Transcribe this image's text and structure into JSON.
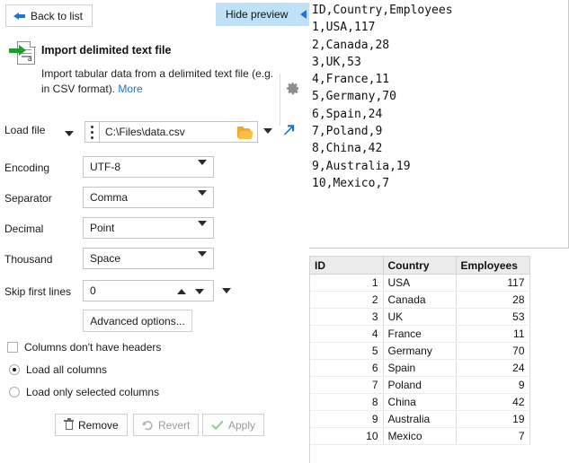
{
  "toolbar": {
    "back_label": "Back to list",
    "back_icon": "arrow-left-icon",
    "hide_preview_label": "Hide preview",
    "hide_preview_icon": "triangle-left-icon"
  },
  "header": {
    "icon": "import-text-file-icon",
    "title": "Import delimited text file",
    "description": "Import tabular data from a delimited text file (e.g. in CSV format).",
    "more_link": "More",
    "settings_icon": "gear-icon"
  },
  "form": {
    "load_file": {
      "label": "Load file",
      "value": "C:\\Files\\data.csv",
      "browse_icon": "folder-open-icon",
      "dropdown_icon": "chevron-down-icon",
      "open_external_icon": "arrow-diagonal-icon",
      "handle_icon": "drag-dots-icon"
    },
    "encoding": {
      "label": "Encoding",
      "value": "UTF-8"
    },
    "separator": {
      "label": "Separator",
      "value": "Comma"
    },
    "decimal": {
      "label": "Decimal",
      "value": "Point"
    },
    "thousand": {
      "label": "Thousand",
      "value": "Space"
    },
    "skip_first_lines": {
      "label": "Skip first lines",
      "value": "0",
      "up_icon": "spinner-up-icon",
      "down_icon": "spinner-down-icon"
    },
    "advanced_options_label": "Advanced options...",
    "no_headers": {
      "label": "Columns don't have headers",
      "checked": false
    },
    "load_all": {
      "label": "Load all columns",
      "selected": true
    },
    "load_selected": {
      "label": "Load only selected columns",
      "selected": false
    }
  },
  "actions": {
    "remove": {
      "label": "Remove",
      "icon": "trash-icon",
      "enabled": true
    },
    "revert": {
      "label": "Revert",
      "icon": "undo-icon",
      "enabled": false
    },
    "apply": {
      "label": "Apply",
      "icon": "check-icon",
      "enabled": false
    }
  },
  "preview": {
    "raw_text": "ID,Country,Employees\n1,USA,117\n2,Canada,28\n3,UK,53\n4,France,11\n5,Germany,70\n6,Spain,24\n7,Poland,9\n8,China,42\n9,Australia,19\n10,Mexico,7",
    "table": {
      "columns": [
        "ID",
        "Country",
        "Employees"
      ],
      "rows": [
        [
          "1",
          "USA",
          "117"
        ],
        [
          "2",
          "Canada",
          "28"
        ],
        [
          "3",
          "UK",
          "53"
        ],
        [
          "4",
          "France",
          "11"
        ],
        [
          "5",
          "Germany",
          "70"
        ],
        [
          "6",
          "Spain",
          "24"
        ],
        [
          "7",
          "Poland",
          "9"
        ],
        [
          "8",
          "China",
          "42"
        ],
        [
          "9",
          "Australia",
          "19"
        ],
        [
          "10",
          "Mexico",
          "7"
        ]
      ]
    }
  },
  "colors": {
    "accent_blue": "#1b74d6",
    "highlight_blue": "#bfe1f7",
    "green": "#1f9e2c",
    "folder_orange": "#f0a92a",
    "header_gray": "#ebebeb"
  }
}
